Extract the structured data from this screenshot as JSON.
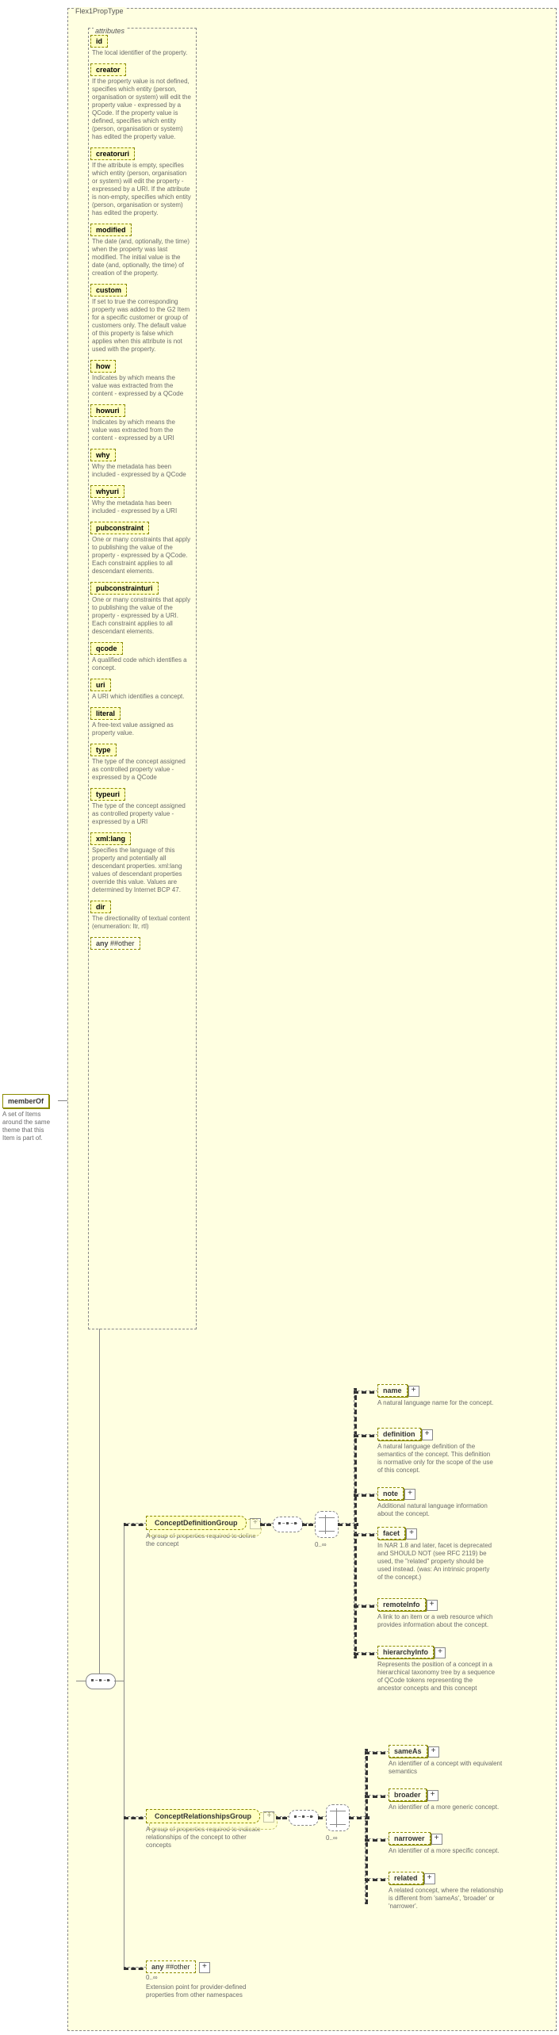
{
  "root": {
    "type_name": "Flex1PropType",
    "element": "memberOf",
    "element_desc": "A set of Items around the same theme that this Item is part of."
  },
  "attributes": [
    {
      "name": "id",
      "desc": "The local identifier of the property."
    },
    {
      "name": "creator",
      "desc": "If the property value is not defined, specifies which entity (person, organisation or system) will edit the property value - expressed by a QCode. If the property value is defined, specifies which entity (person, organisation or system) has edited the property value."
    },
    {
      "name": "creatoruri",
      "desc": "If the attribute is empty, specifies which entity (person, organisation or system) will edit the property - expressed by a URI. If the attribute is non-empty, specifies which entity (person, organisation or system) has edited the property."
    },
    {
      "name": "modified",
      "desc": "The date (and, optionally, the time) when the property was last modified. The initial value is the date (and, optionally, the time) of creation of the property."
    },
    {
      "name": "custom",
      "desc": "If set to true the corresponding property was added to the G2 Item for a specific customer or group of customers only. The default value of this property is false which applies when this attribute is not used with the property."
    },
    {
      "name": "how",
      "desc": "Indicates by which means the value was extracted from the content - expressed by a QCode"
    },
    {
      "name": "howuri",
      "desc": "Indicates by which means the value was extracted from the content - expressed by a URI"
    },
    {
      "name": "why",
      "desc": "Why the metadata has been included - expressed by a QCode"
    },
    {
      "name": "whyuri",
      "desc": "Why the metadata has been included - expressed by a URI"
    },
    {
      "name": "pubconstraint",
      "desc": "One or many constraints that apply to publishing the value of the property - expressed by a QCode. Each constraint applies to all descendant elements."
    },
    {
      "name": "pubconstrainturi",
      "desc": "One or many constraints that apply to publishing the value of the property - expressed by a URI. Each constraint applies to all descendant elements."
    },
    {
      "name": "qcode",
      "desc": "A qualified code which identifies a concept."
    },
    {
      "name": "uri",
      "desc": "A URI which identifies a concept."
    },
    {
      "name": "literal",
      "desc": "A free-text value assigned as property value."
    },
    {
      "name": "type",
      "desc": "The type of the concept assigned as controlled property value - expressed by a QCode"
    },
    {
      "name": "typeuri",
      "desc": "The type of the concept assigned as controlled property value - expressed by a URI"
    },
    {
      "name": "xml:lang",
      "desc": "Specifies the language of this property and potentially all descendant properties. xml:lang values of descendant properties override this value. Values are determined by Internet BCP 47."
    },
    {
      "name": "dir",
      "desc": "The directionality of textual content (enumeration: ltr, rtl)"
    }
  ],
  "attr_any": {
    "label": "any",
    "suffix": "##other"
  },
  "def_group": {
    "label": "ConceptDefinitionGroup",
    "desc": "A group of properties required to define the concept"
  },
  "rel_group": {
    "label": "ConceptRelationshipsGroup",
    "desc": "A group of properties required to indicate relationships of the concept to other concepts"
  },
  "def_children": [
    {
      "name": "name",
      "desc": "A natural language name for the concept."
    },
    {
      "name": "definition",
      "desc": "A natural language definition of the semantics of the concept. This definition is normative only for the scope of the use of this concept."
    },
    {
      "name": "note",
      "desc": "Additional natural language information about the concept."
    },
    {
      "name": "facet",
      "desc": "In NAR 1.8 and later, facet is deprecated and SHOULD NOT (see RFC 2119) be used, the \"related\" property should be used instead. (was: An intrinsic property of the concept.)"
    },
    {
      "name": "remoteInfo",
      "desc": "A link to an item or a web resource which provides information about the concept."
    },
    {
      "name": "hierarchyInfo",
      "desc": "Represents the position of a concept in a hierarchical taxonomy tree by a sequence of QCode tokens representing the ancestor concepts and this concept"
    }
  ],
  "rel_children": [
    {
      "name": "sameAs",
      "desc": "An identifier of a concept with equivalent semantics"
    },
    {
      "name": "broader",
      "desc": "An identifier of a more generic concept."
    },
    {
      "name": "narrower",
      "desc": "An identifier of a more specific concept."
    },
    {
      "name": "related",
      "desc": "A related concept, where the relationship is different from 'sameAs', 'broader' or 'narrower'."
    }
  ],
  "cardinality": "0..∞",
  "any_bottom": {
    "label": "any",
    "suffix": "##other",
    "desc": "Extension point for provider-defined properties from other namespaces",
    "card": "0..∞"
  }
}
